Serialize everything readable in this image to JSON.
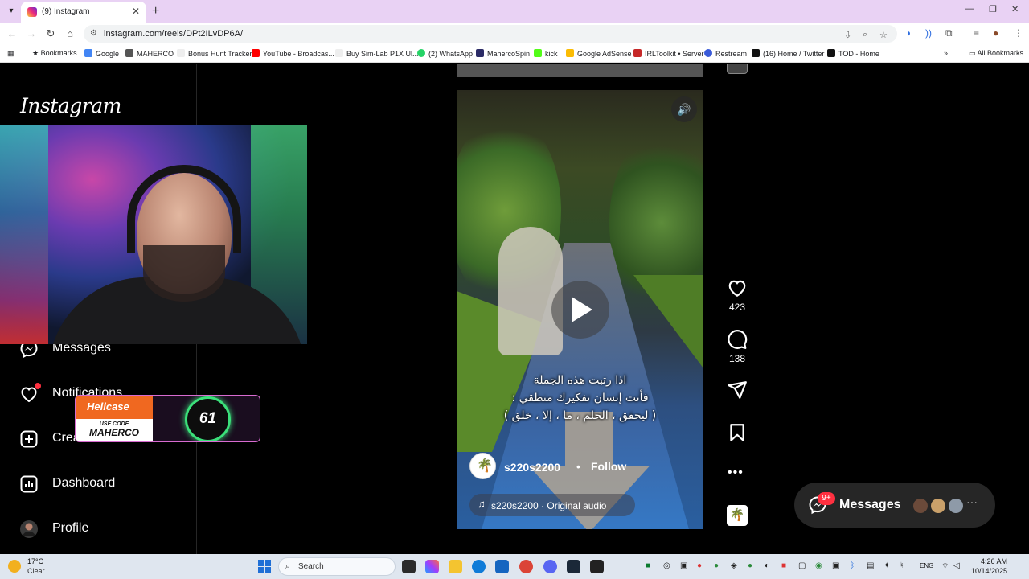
{
  "browser": {
    "tab_title": "(9) Instagram",
    "url": "instagram.com/reels/DPt2ILvDP6A/",
    "bookmarks": [
      "Bookmarks",
      "Google",
      "MAHERCO",
      "Bonus Hunt Tracker",
      "YouTube - Broadcas...",
      "Buy Sim-Lab P1X Ul...",
      "(2) WhatsApp",
      "MahercoSpin",
      "kick",
      "Google AdSense",
      "IRLToolkit • Server",
      "Restream",
      "(16) Home / Twitter",
      "TOD - Home"
    ],
    "all_bookmarks": "All Bookmarks",
    "colors": {
      "tabbar": "#e9d2f4"
    }
  },
  "sidebar": {
    "logo": "Instagram",
    "items": [
      {
        "label": "Messages",
        "icon": "messenger-icon"
      },
      {
        "label": "Notifications",
        "icon": "heart-icon"
      },
      {
        "label": "Create",
        "icon": "plus-square-icon"
      },
      {
        "label": "Dashboard",
        "icon": "dashboard-icon"
      },
      {
        "label": "Profile",
        "icon": "avatar"
      }
    ]
  },
  "overlay": {
    "brand": "Hellcase",
    "code_label": "USE CODE",
    "code": "MAHERCO",
    "counter": "61"
  },
  "reel": {
    "caption_lines": [
      "اذا رتبت هذه الجملة",
      "فأنت إنسان تفكيرك منطقي :",
      "( ليحقق ، الحلم ، ما ، إلا ، خلق )"
    ],
    "author": "s220s2200",
    "separator": "•",
    "follow_label": "Follow",
    "audio": "s220s2200 · Original audio",
    "likes": "423",
    "comments": "138"
  },
  "messages_pill": {
    "label": "Messages",
    "badge": "9+"
  },
  "taskbar": {
    "temp": "17°C",
    "condition": "Clear",
    "search": "Search",
    "lang": "ENG",
    "time": "4:26 AM",
    "date": "10/14/2025"
  }
}
